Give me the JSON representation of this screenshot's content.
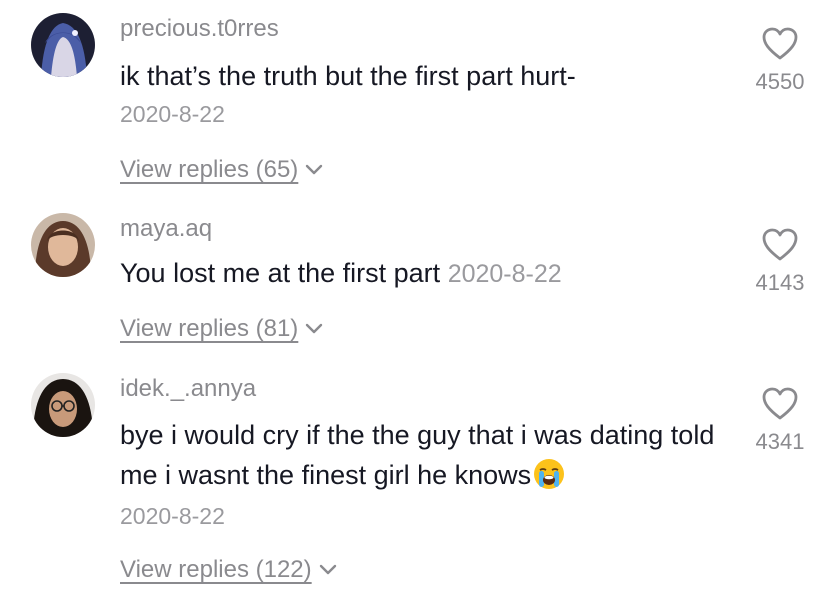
{
  "comments": [
    {
      "username": "precious.t0rres",
      "text": "ik that’s the truth but the first part hurt-",
      "date": "2020-8-22",
      "replies": "View replies (65)",
      "likes": "4550"
    },
    {
      "username": "maya.aq",
      "text": "You lost me at the first part",
      "date": "2020-8-22",
      "replies": "View replies (81)",
      "likes": "4143"
    },
    {
      "username": "idek._.annya",
      "text": "bye i would cry if the the guy that i was dating told me i wasnt the finest girl he knows",
      "emoji": "crying-face-emoji",
      "date": "2020-8-22",
      "replies": "View replies (122)",
      "likes": "4341"
    }
  ],
  "colors": {
    "text": "#161823",
    "meta": "#8a8a8e"
  },
  "icons": [
    "heart-icon",
    "chevron-down-icon"
  ]
}
